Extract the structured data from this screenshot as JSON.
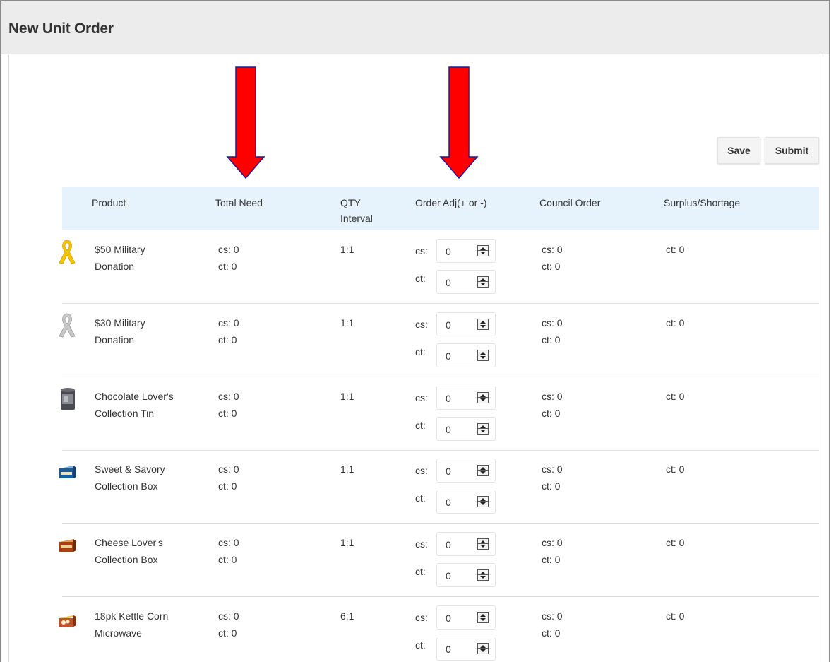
{
  "header": {
    "title": "New Unit Order"
  },
  "toolbar": {
    "save_label": "Save",
    "submit_label": "Submit"
  },
  "colors": {
    "arrow": "#ff0000",
    "header_bg": "#ececec",
    "table_head_bg": "#e6f3fd"
  },
  "table": {
    "headers": {
      "product": "Product",
      "total_need": "Total Need",
      "qty_interval_line1": "QTY",
      "qty_interval_line2": "Interval",
      "order_adj": "Order Adj(+ or -)",
      "council_order": "Council Order",
      "surplus_shortage": "Surplus/Shortage"
    },
    "labels": {
      "cs": "cs:",
      "ct": "ct:"
    },
    "rows": [
      {
        "name1": "$50 Military",
        "name2": "Donation",
        "icon": "yellow-ribbon-icon",
        "need_cs": "cs: 0",
        "need_ct": "ct: 0",
        "interval": "1:1",
        "adj_cs": "0",
        "adj_ct": "0",
        "council_cs": "cs: 0",
        "council_ct": "ct: 0",
        "surplus": "ct: 0"
      },
      {
        "name1": "$30 Military",
        "name2": "Donation",
        "icon": "silver-ribbon-icon",
        "need_cs": "cs: 0",
        "need_ct": "ct: 0",
        "interval": "1:1",
        "adj_cs": "0",
        "adj_ct": "0",
        "council_cs": "cs: 0",
        "council_ct": "ct: 0",
        "surplus": "ct: 0"
      },
      {
        "name1": "Chocolate Lover's",
        "name2": "Collection Tin",
        "icon": "tin-icon",
        "need_cs": "cs: 0",
        "need_ct": "ct: 0",
        "interval": "1:1",
        "adj_cs": "0",
        "adj_ct": "0",
        "council_cs": "cs: 0",
        "council_ct": "ct: 0",
        "surplus": "ct: 0"
      },
      {
        "name1": "Sweet & Savory",
        "name2": "Collection Box",
        "icon": "blue-box-icon",
        "need_cs": "cs: 0",
        "need_ct": "ct: 0",
        "interval": "1:1",
        "adj_cs": "0",
        "adj_ct": "0",
        "council_cs": "cs: 0",
        "council_ct": "ct: 0",
        "surplus": "ct: 0"
      },
      {
        "name1": "Cheese Lover's",
        "name2": "Collection Box",
        "icon": "orange-box-icon",
        "need_cs": "cs: 0",
        "need_ct": "ct: 0",
        "interval": "1:1",
        "adj_cs": "0",
        "adj_ct": "0",
        "council_cs": "cs: 0",
        "council_ct": "ct: 0",
        "surplus": "ct: 0"
      },
      {
        "name1": "18pk Kettle Corn",
        "name2": "Microwave",
        "icon": "popcorn-box-icon",
        "need_cs": "cs: 0",
        "need_ct": "ct: 0",
        "interval": "6:1",
        "adj_cs": "0",
        "adj_ct": "0",
        "council_cs": "cs: 0",
        "council_ct": "ct: 0",
        "surplus": "ct: 0"
      }
    ]
  }
}
